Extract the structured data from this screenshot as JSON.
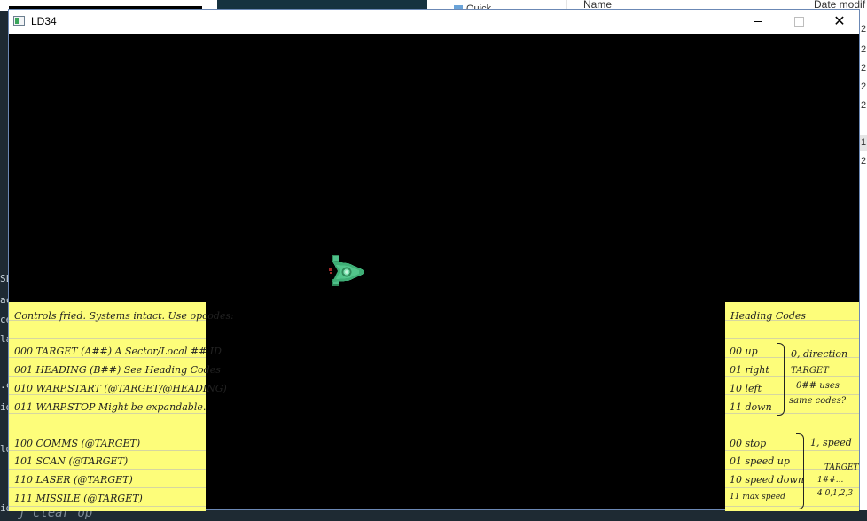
{
  "window": {
    "title": "LD34"
  },
  "background": {
    "explorer": {
      "nav_item": "Quick",
      "col_name": "Name",
      "col_date": "Date modif",
      "date_fragments": [
        "2",
        "2",
        "2",
        "2",
        "2",
        "1",
        "2"
      ]
    },
    "code_fragments": [
      "SL",
      "ac",
      "ce",
      "la",
      ".c",
      "id",
      "ld",
      "id"
    ],
    "code_bottom": "j  clear op"
  },
  "notes": {
    "left": {
      "header": "Controls fried. Systems intact. Use opcodes:",
      "lines": [
        "000 TARGET (A##) A Sector/Local ## ID",
        "001 HEADING (B##) See Heading Codes",
        "010 WARP.START (@TARGET/@HEADING)",
        "011 WARP.STOP  Might be expandable.",
        "100 COMMS (@TARGET)",
        "101 SCAN (@TARGET)",
        "110 LASER (@TARGET)",
        "111 MISSILE (@TARGET)"
      ]
    },
    "right": {
      "header": "Heading Codes",
      "codes": [
        "00 up",
        "01 right",
        "10 left",
        "11 down"
      ],
      "codes_note": [
        "0, direction",
        "TARGET",
        "0## uses",
        "same codes?"
      ],
      "speed": [
        "00 stop",
        "01 speed up",
        "10 speed down",
        "11 max speed"
      ],
      "speed_note": [
        "1, speed",
        "TARGET",
        "1##...",
        "4 0,1,2,3"
      ]
    }
  }
}
